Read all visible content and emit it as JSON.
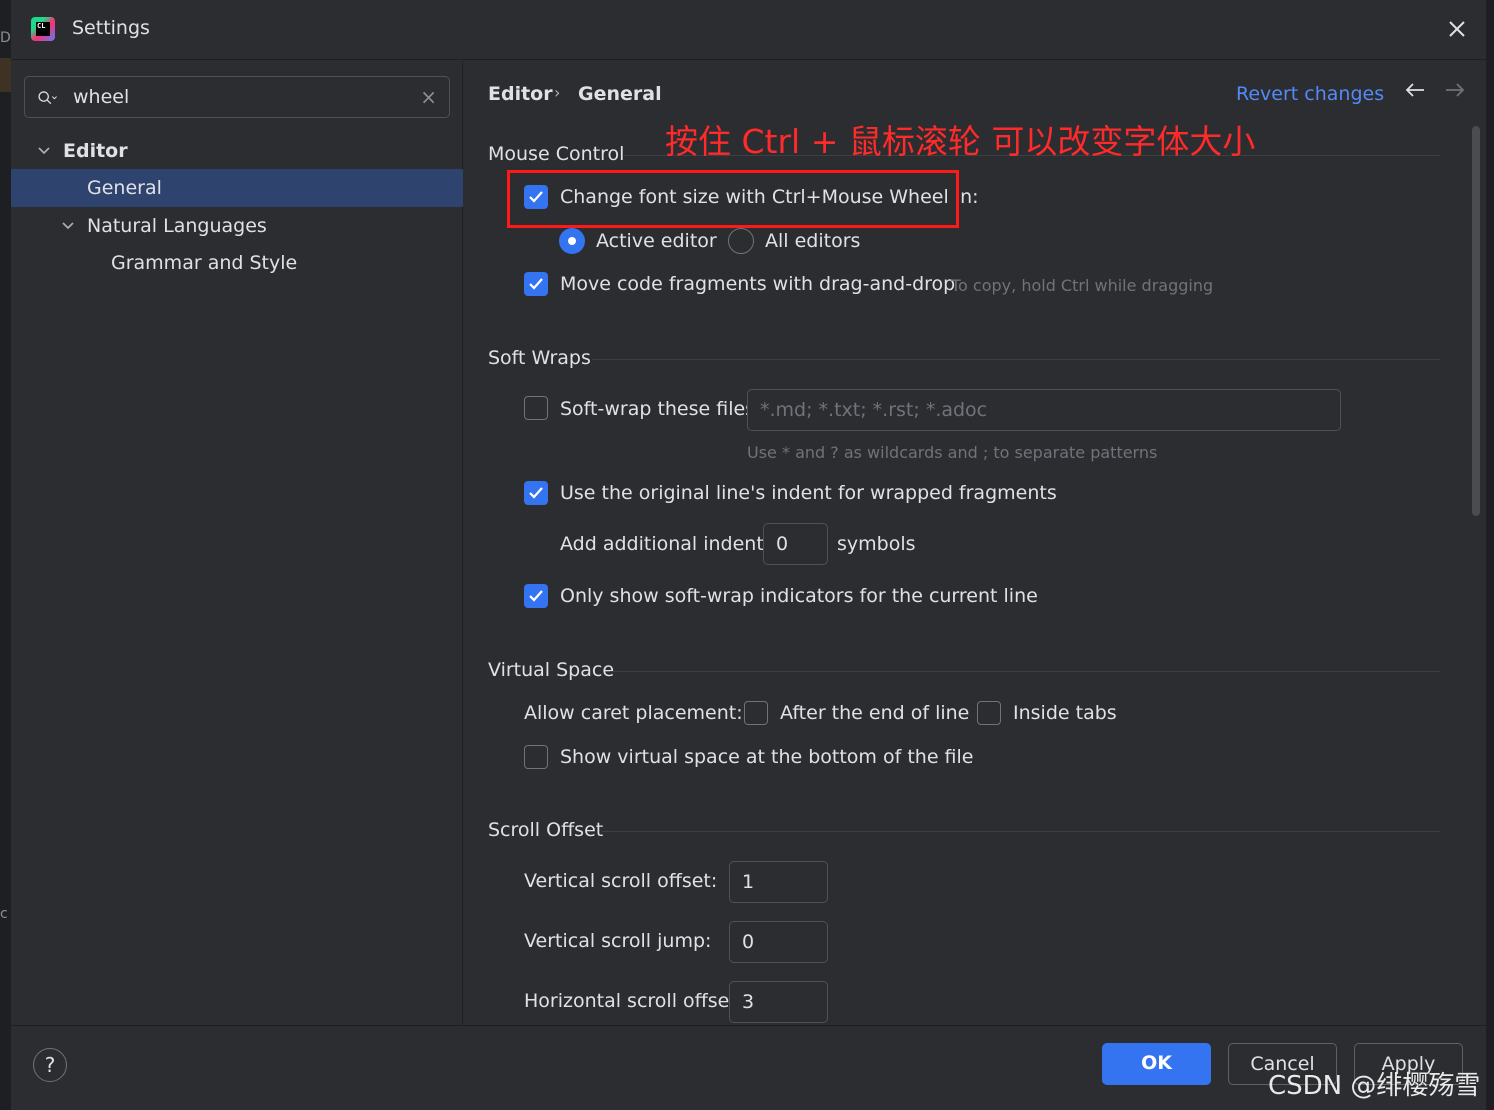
{
  "window": {
    "title": "Settings"
  },
  "edge": {
    "mark1": "D",
    "mark2": "c"
  },
  "search": {
    "value": "wheel",
    "clear": "×"
  },
  "tree": {
    "editor": "Editor",
    "general": "General",
    "natural_languages": "Natural Languages",
    "grammar_and_style": "Grammar and Style"
  },
  "breadcrumb": {
    "parent": "Editor",
    "sep": "›",
    "current": "General"
  },
  "revert_label": "Revert changes",
  "annotation": "按住 Ctrl + 鼠标滚轮 可以改变字体大小",
  "mouse_control": {
    "title": "Mouse Control",
    "change_font": {
      "label": "Change font size with Ctrl+Mouse Wheel in:",
      "checked": true
    },
    "active_editor": {
      "label": "Active editor",
      "selected": true
    },
    "all_editors": {
      "label": "All editors",
      "selected": false
    },
    "drag_drop": {
      "label": "Move code fragments with drag-and-drop",
      "checked": true,
      "hint": "To copy, hold Ctrl while dragging"
    }
  },
  "soft_wraps": {
    "title": "Soft Wraps",
    "soft_wrap_files": {
      "label": "Soft-wrap these files:",
      "checked": false,
      "placeholder": "*.md; *.txt; *.rst; *.adoc",
      "hint": "Use * and ? as wildcards and ; to separate patterns"
    },
    "original_indent": {
      "label": "Use the original line's indent for wrapped fragments",
      "checked": true
    },
    "additional_indent": {
      "label": "Add additional indent:",
      "value": "0",
      "unit": "symbols"
    },
    "indicators": {
      "label": "Only show soft-wrap indicators for the current line",
      "checked": true
    }
  },
  "virtual_space": {
    "title": "Virtual Space",
    "caret_label": "Allow caret placement:",
    "after_end": {
      "label": "After the end of line",
      "checked": false
    },
    "inside_tabs": {
      "label": "Inside tabs",
      "checked": false
    },
    "bottom": {
      "label": "Show virtual space at the bottom of the file",
      "checked": false
    }
  },
  "scroll_offset": {
    "title": "Scroll Offset",
    "vertical_offset": {
      "label": "Vertical scroll offset:",
      "value": "1"
    },
    "vertical_jump": {
      "label": "Vertical scroll jump:",
      "value": "0"
    },
    "horizontal_offset": {
      "label": "Horizontal scroll offset:",
      "value": "3"
    }
  },
  "buttons": {
    "help": "?",
    "ok": "OK",
    "cancel": "Cancel",
    "apply": "Apply"
  },
  "watermark": "CSDN @绯樱殇雪",
  "colors": {
    "accent": "#3574f0",
    "link": "#548af7",
    "annotation": "#ff2a2a",
    "selection": "#2e436e"
  }
}
